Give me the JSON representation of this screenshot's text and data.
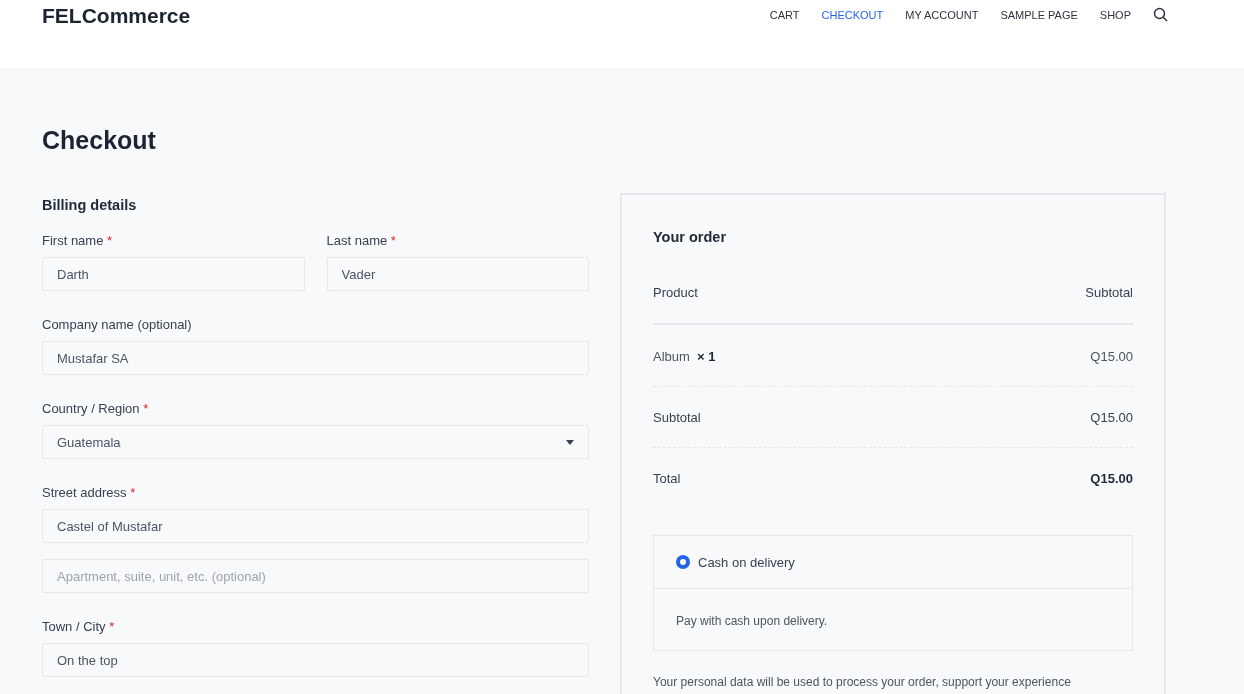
{
  "header": {
    "logo": "FELCommerce",
    "nav": [
      {
        "label": "CART",
        "selected": false
      },
      {
        "label": "CHECKOUT",
        "selected": true
      },
      {
        "label": "MY ACCOUNT",
        "selected": false
      },
      {
        "label": "SAMPLE PAGE",
        "selected": false
      },
      {
        "label": "SHOP",
        "selected": false
      }
    ]
  },
  "page_title": "Checkout",
  "billing": {
    "heading": "Billing details",
    "rows": [
      [
        {
          "kind": "text",
          "label": "First name",
          "required_mark": "*",
          "value": "Darth"
        },
        {
          "kind": "text",
          "label": "Last name",
          "required_mark": "*",
          "value": "Vader"
        }
      ],
      [
        {
          "kind": "text",
          "label": "Company name (optional)",
          "value": "Mustafar SA"
        }
      ],
      [
        {
          "kind": "select",
          "label": "Country / Region",
          "required_mark": "*",
          "value": "Guatemala"
        }
      ],
      [
        {
          "kind": "text",
          "label": "Street address",
          "required_mark": "*",
          "value": "Castel of Mustafar"
        }
      ],
      [
        {
          "kind": "text",
          "placeholder": "Apartment, suite, unit, etc. (optional)"
        }
      ],
      [
        {
          "kind": "text",
          "label": "Town / City",
          "required_mark": "*",
          "value": "On the top"
        }
      ]
    ]
  },
  "order": {
    "heading": "Your order",
    "columns": [
      "Product",
      "Subtotal"
    ],
    "items": [
      {
        "name": "Album",
        "qty": "× 1",
        "amount": "Q15.00"
      }
    ],
    "subtotal": {
      "label": "Subtotal",
      "amount": "Q15.00"
    },
    "total": {
      "label": "Total",
      "amount": "Q15.00"
    },
    "payment_methods": [
      {
        "label": "Cash on delivery",
        "selected": true,
        "description": "Pay with cash upon delivery."
      }
    ],
    "privacy_text": "Your personal data will be used to process your order, support your experience"
  }
}
